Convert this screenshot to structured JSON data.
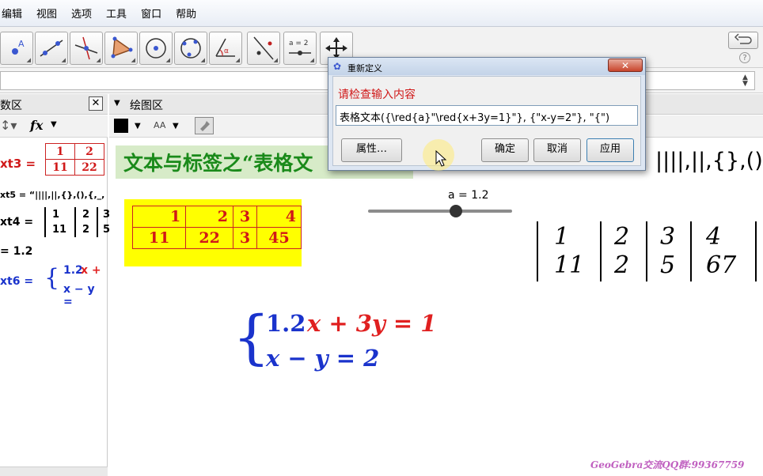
{
  "menu": [
    "编辑",
    "视图",
    "选项",
    "工具",
    "窗口",
    "帮助"
  ],
  "tools": [
    {
      "icon": "point-icon",
      "label": "A"
    },
    {
      "icon": "line-icon"
    },
    {
      "icon": "perpendicular-line-icon"
    },
    {
      "icon": "polygon-icon"
    },
    {
      "icon": "circle-center-point-icon"
    },
    {
      "icon": "circle-three-points-icon"
    },
    {
      "icon": "angle-icon",
      "label": "α"
    },
    {
      "icon": "reflect-icon"
    },
    {
      "icon": "slider-icon",
      "label": "a = 2"
    },
    {
      "icon": "move-view-icon"
    }
  ],
  "undo_icon": "undo-icon",
  "help_label": "?",
  "algebra": {
    "header": "数区",
    "close_label": "✕",
    "style_bar": "fx",
    "text3_label": "xt3 =",
    "text3_table": [
      [
        "1",
        "2"
      ],
      [
        "11",
        "22"
      ]
    ],
    "text5": "xt5 = “||||,||,{},(),{,_,",
    "text4_label": "xt4 =",
    "text4_table": [
      [
        "1",
        "2",
        "3"
      ],
      [
        "11",
        "2",
        "5"
      ]
    ],
    "a_value": "= 1.2",
    "text6_label": "xt6 =",
    "text6_line1_a": "1.2",
    "text6_line1_b": "x +",
    "text6_line2": "x − y ="
  },
  "graphics": {
    "header": "绘图区",
    "font_size_label": "AA",
    "title_prefix": "文本与标签之“表格文",
    "table": [
      [
        "1",
        "2",
        "3",
        "4"
      ],
      [
        "11",
        "22",
        "3",
        "45"
      ]
    ],
    "slider_label": "a = 1.2",
    "slider_value": 1.2,
    "slider_fraction": 0.61,
    "delims": "||||,||,{},(),{",
    "table2": [
      [
        "1",
        "2",
        "3",
        "4"
      ],
      [
        "11",
        "2",
        "5",
        "67"
      ]
    ],
    "eq1_coef": "1.2",
    "eq1_rest": "x + 3y = 1",
    "eq2": "x − y = 2",
    "watermark": "GeoGebra交流QQ群:99367759"
  },
  "dialog": {
    "title": "重新定义",
    "close_label": "✕",
    "prompt": "请检查输入内容",
    "input_value": "表格文本({\\red{a}\"\\red{x+3y=1}\"}, {\"x-y=2\"}, \"{\")",
    "properties_button": "属性…",
    "ok_button": "确定",
    "cancel_button": "取消",
    "apply_button": "应用"
  },
  "colors": {
    "table_fill": "#ffff00",
    "title_bg": "#d7ebc8",
    "eq_blue": "#1a33cc",
    "eq_red": "#e02020",
    "red_text": "#d01818",
    "watermark": "#c060c0"
  }
}
